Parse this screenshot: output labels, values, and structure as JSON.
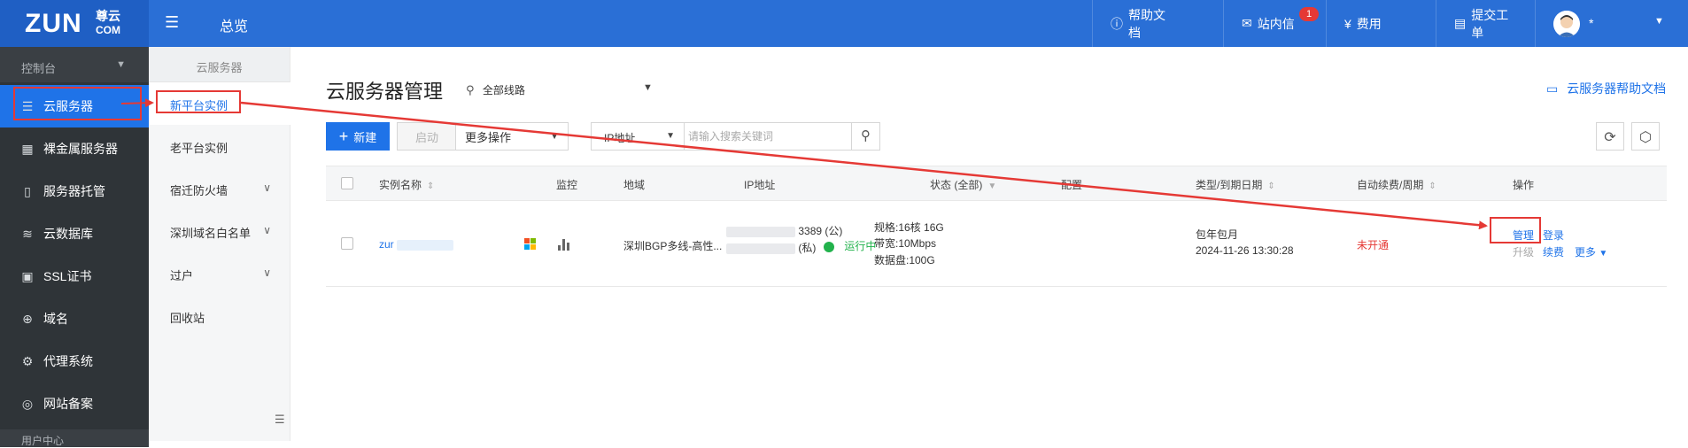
{
  "topbar": {
    "logo_text": "ZUN",
    "logo_dot": ".",
    "logo_cn": "尊云",
    "logo_com": "COM",
    "title": "总览",
    "nav": [
      {
        "label": "帮助文档",
        "icon": "help-circle-icon"
      },
      {
        "label": "站内信",
        "icon": "mail-icon",
        "badge": "1"
      },
      {
        "label": "费用",
        "icon": "yen-coin-icon"
      },
      {
        "label": "提交工单",
        "icon": "ticket-doc-icon"
      }
    ],
    "username": "*"
  },
  "sidebar": {
    "section_label": "控制台",
    "items": [
      {
        "label": "云服务器",
        "icon": "server-stack-icon",
        "active": true
      },
      {
        "label": "裸金属服务器",
        "icon": "bare-metal-icon"
      },
      {
        "label": "服务器托管",
        "icon": "server-hosting-icon"
      },
      {
        "label": "云数据库",
        "icon": "database-icon"
      },
      {
        "label": "SSL证书",
        "icon": "ssl-certificate-icon"
      },
      {
        "label": "域名",
        "icon": "globe-icon"
      },
      {
        "label": "代理系统",
        "icon": "settings-gear-icon"
      },
      {
        "label": "网站备案",
        "icon": "record-target-icon"
      }
    ],
    "bottom_section_label": "用户中心"
  },
  "subnav": {
    "header": "云服务器",
    "items": [
      {
        "label": "新平台实例",
        "active": true
      },
      {
        "label": "老平台实例"
      },
      {
        "label": "宿迁防火墙",
        "expandable": true
      },
      {
        "label": "深圳域名白名单",
        "expandable": true
      },
      {
        "label": "过户",
        "expandable": true
      },
      {
        "label": "回收站"
      }
    ]
  },
  "main": {
    "title": "云服务器管理",
    "region_selector": "全部线路",
    "help_link": "云服务器帮助文档",
    "toolbar": {
      "new_label": "新建",
      "start_label": "启动",
      "more_label": "更多操作",
      "search_field": "IP地址",
      "search_placeholder": "请输入搜索关键词"
    },
    "table": {
      "headers": {
        "name": "实例名称",
        "monitor": "监控",
        "region": "地域",
        "ip": "IP地址",
        "status": "状态 (全部)",
        "config": "配置",
        "type_expiry": "类型/到期日期",
        "autorenew": "自动续费/周期",
        "actions": "操作"
      },
      "rows": [
        {
          "name": "zur",
          "region": "深圳BGP多线-高性...",
          "ip_public": "3389 (公)",
          "ip_private": "(私)",
          "status": "运行中",
          "config_cpu": "规格:16核 16G",
          "config_bw": "带宽:10Mbps",
          "config_disk": "数据盘:100G",
          "billing_type": "包年包月",
          "expiry": "2024-11-26 13:30:28",
          "autorenew": "未开通",
          "action_manage": "管理",
          "action_login": "登录",
          "action_upgrade": "升级",
          "action_renew": "续费",
          "action_more": "更多"
        }
      ]
    }
  },
  "colors": {
    "topbar": "#2a6fd6",
    "sidebar": "#2f3438",
    "accent": "#1f73e8",
    "annotation": "#e53935",
    "running": "#22b24c",
    "autorenew_off": "#e53935"
  }
}
